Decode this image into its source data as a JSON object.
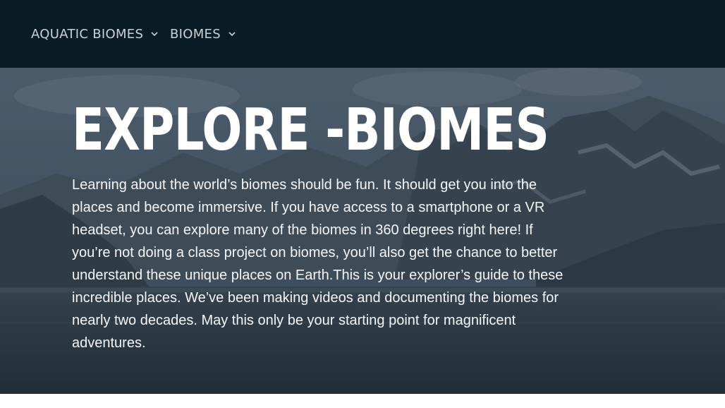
{
  "nav": {
    "items": [
      {
        "label": "AQUATIC BIOMES",
        "icon": "chevron-down-icon"
      },
      {
        "label": "BIOMES",
        "icon": "chevron-down-icon"
      }
    ]
  },
  "hero": {
    "title": "EXPLORE -BIOMES",
    "body": "Learning about the world’s biomes should be fun. It should get you into the places and become immersive. If you have access to a smartphone or a VR headset, you can explore many of the biomes in 360 degrees right here! If you’re not doing a class project on biomes, you’ll also get the chance to better understand these unique places on Earth.This is your explorer’s guide to these incredible places. We’ve been making videos and documenting the biomes for nearly two decades. May this only be your starting point for magnificent adventures."
  },
  "colors": {
    "navbar_bg": "#0b1b26",
    "nav_text": "#c9d1d6",
    "hero_text": "#ffffff"
  }
}
